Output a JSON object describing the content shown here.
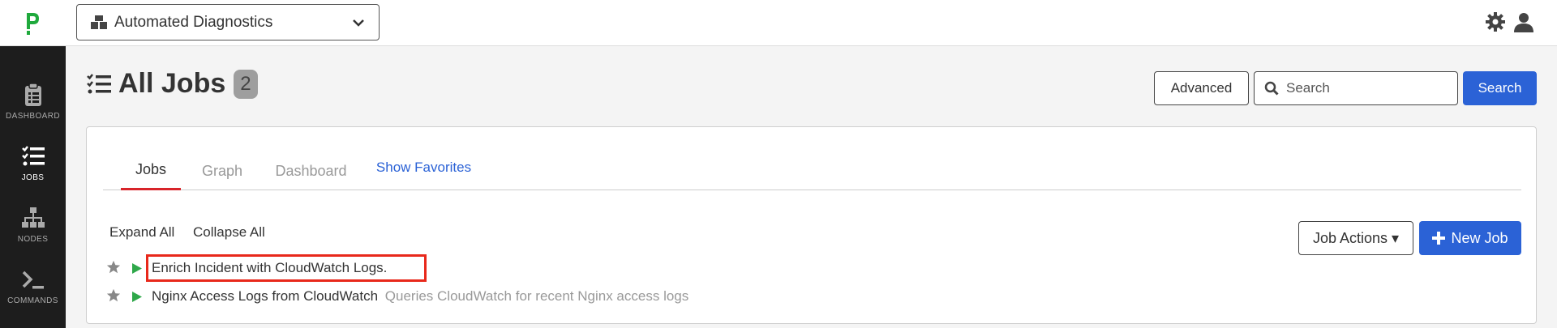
{
  "header": {
    "project": "Automated Diagnostics",
    "project_icon": "boxes-icon",
    "settings_icon": "gear-icon",
    "user_icon": "user-icon"
  },
  "sidebar": {
    "items": [
      {
        "label": "DASHBOARD",
        "icon": "clipboard-icon"
      },
      {
        "label": "JOBS",
        "icon": "tasks-icon",
        "active": true
      },
      {
        "label": "NODES",
        "icon": "sitemap-icon"
      },
      {
        "label": "COMMANDS",
        "icon": "terminal-icon"
      }
    ]
  },
  "page": {
    "title": "All Jobs",
    "count": "2"
  },
  "toolbar": {
    "advanced": "Advanced",
    "search_placeholder": "Search",
    "search_button": "Search"
  },
  "tabs": [
    {
      "label": "Jobs",
      "active": true
    },
    {
      "label": "Graph"
    },
    {
      "label": "Dashboard"
    },
    {
      "label": "Show Favorites"
    }
  ],
  "actions": {
    "expand_all": "Expand All",
    "collapse_all": "Collapse All",
    "job_actions": "Job Actions",
    "new_job": "New Job"
  },
  "jobs": [
    {
      "name": "Enrich Incident with CloudWatch Logs.",
      "description": ""
    },
    {
      "name": "Nginx Access Logs from CloudWatch",
      "description": "Queries CloudWatch for recent Nginx access logs"
    }
  ],
  "colors": {
    "accent": "#2b62d6",
    "run": "#2fa84a",
    "active_tab": "#d8242a",
    "highlight": "#e8281b",
    "logo": "#1fa93c"
  }
}
